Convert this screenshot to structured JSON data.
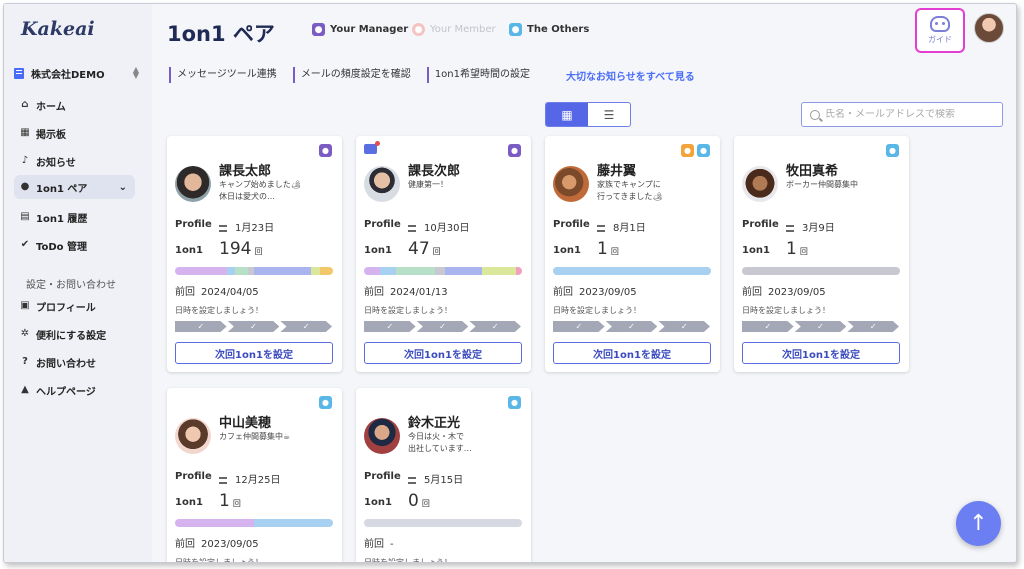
{
  "app": {
    "logo": "Kakeai",
    "company": "株式会社DEMO"
  },
  "sidebar": {
    "items": [
      {
        "label": "ホーム",
        "icon": "home-icon"
      },
      {
        "label": "掲示板",
        "icon": "board-icon"
      },
      {
        "label": "お知らせ",
        "icon": "bell-icon"
      },
      {
        "label": "1on1 ペア",
        "icon": "person-icon"
      },
      {
        "label": "1on1 履歴",
        "icon": "history-icon"
      },
      {
        "label": "ToDo 管理",
        "icon": "check-icon"
      }
    ],
    "section_label": "設定・お問い合わせ",
    "settings": [
      {
        "label": "プロフィール",
        "icon": "profile-icon"
      },
      {
        "label": "便利にする設定",
        "icon": "gear-icon"
      },
      {
        "label": "お問い合わせ",
        "icon": "question-icon"
      },
      {
        "label": "ヘルプページ",
        "icon": "graduation-icon"
      }
    ]
  },
  "header": {
    "title": "1on1 ペア",
    "legend": [
      {
        "label": "Your Manager",
        "color": "#7b5cc4"
      },
      {
        "label": "Your Member",
        "color": "#f2a0a0"
      },
      {
        "label": "The Others",
        "color": "#59b7e8"
      }
    ],
    "guide_label": "ガイド"
  },
  "links": {
    "items": [
      "メッセージツール連携",
      "メールの頻度設定を確認",
      "1on1希望時間の設定"
    ],
    "all_notices": "大切なお知らせをすべて見る"
  },
  "search": {
    "placeholder": "氏名・メールアドレスで検索"
  },
  "labels": {
    "profile": "Profile",
    "oneonone": "1on1",
    "times_unit": "回",
    "prev": "前回",
    "set_date_hint": "日時を設定しましょう！",
    "next_button": "次回1on1を設定"
  },
  "cards": [
    {
      "name": "課長太郎",
      "status": [
        "キャンプ始めました🏕",
        "休日は愛犬の…"
      ],
      "birthday": "1月23日",
      "count": "194",
      "prev": "2024/04/05",
      "badges": [
        "manager"
      ]
    },
    {
      "name": "課長次郎",
      "status": [
        "健康第一！"
      ],
      "birthday": "10月30日",
      "count": "47",
      "prev": "2024/01/13",
      "badges": [
        "manager"
      ],
      "chat": true
    },
    {
      "name": "藤井翼",
      "status": [
        "家族でキャンプに",
        "行ってきました🏕"
      ],
      "birthday": "8月1日",
      "count": "1",
      "prev": "2023/09/05",
      "badges": [
        "member",
        "others"
      ]
    },
    {
      "name": "牧田真希",
      "status": [
        "ボーカー仲間募集中"
      ],
      "birthday": "3月9日",
      "count": "1",
      "prev": "2023/09/05",
      "badges": [
        "others"
      ]
    },
    {
      "name": "中山美穂",
      "status": [
        "カフェ仲間募集中☕"
      ],
      "birthday": "12月25日",
      "count": "1",
      "prev": "2023/09/05",
      "badges": [
        "others"
      ]
    },
    {
      "name": "鈴木正光",
      "status": [
        "今日は火・木で",
        "出社しています…"
      ],
      "birthday": "5月15日",
      "count": "0",
      "prev": "-",
      "badges": [
        "others"
      ]
    }
  ],
  "colors": {
    "accent": "#5566e6",
    "manager": "#7b5cc4",
    "others": "#59b7e8",
    "guide_border": "#e23fd2"
  }
}
